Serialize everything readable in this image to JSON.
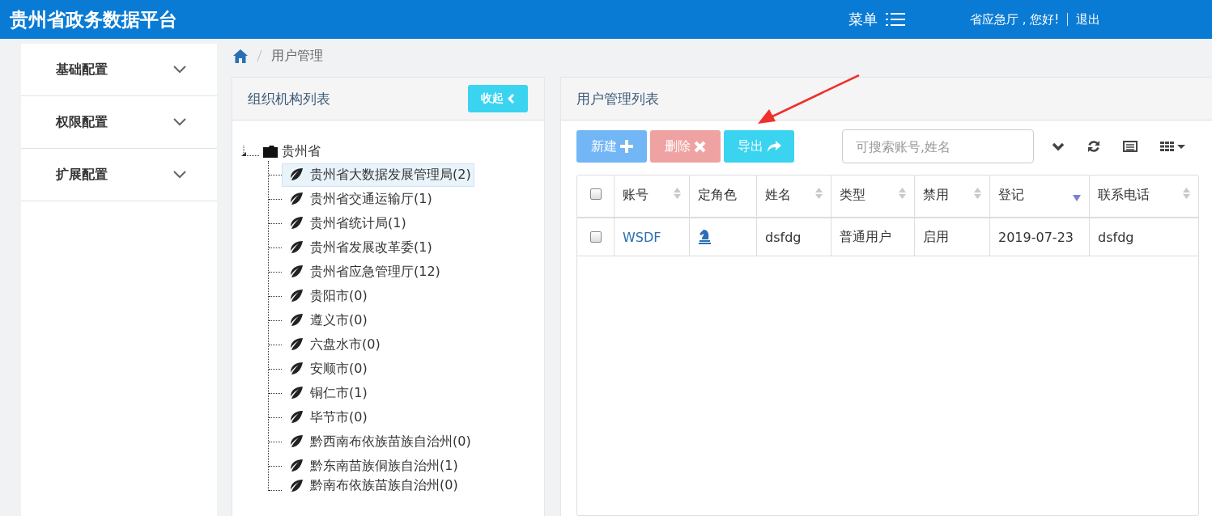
{
  "header": {
    "title": "贵州省政务数据平台",
    "menu_label": "菜单",
    "greeting": "省应急厅 , 您好!",
    "logout": "退出"
  },
  "sidebar": {
    "items": [
      {
        "label": "基础配置",
        "expanded": false
      },
      {
        "label": "权限配置",
        "expanded": false
      },
      {
        "label": "扩展配置",
        "expanded": false
      }
    ]
  },
  "breadcrumb": [
    "用户管理"
  ],
  "org_panel": {
    "title": "组织机构列表",
    "collapse_button": "收起",
    "tree": {
      "label": "贵州省",
      "expanded": true,
      "children": [
        {
          "label": "贵州省大数据发展管理局(2)",
          "selected": true
        },
        {
          "label": "贵州省交通运输厅(1)",
          "selected": false
        },
        {
          "label": "贵州省统计局(1)",
          "selected": false
        },
        {
          "label": "贵州省发展改革委(1)",
          "selected": false
        },
        {
          "label": "贵州省应急管理厅(12)",
          "selected": false
        },
        {
          "label": "贵阳市(0)",
          "selected": false
        },
        {
          "label": "遵义市(0)",
          "selected": false
        },
        {
          "label": "六盘水市(0)",
          "selected": false
        },
        {
          "label": "安顺市(0)",
          "selected": false
        },
        {
          "label": "铜仁市(1)",
          "selected": false
        },
        {
          "label": "毕节市(0)",
          "selected": false
        },
        {
          "label": "黔西南布依族苗族自治州(0)",
          "selected": false
        },
        {
          "label": "黔东南苗族侗族自治州(1)",
          "selected": false
        },
        {
          "label": "黔南布依族苗族自治州(0)",
          "selected": false
        }
      ]
    }
  },
  "user_panel": {
    "title": "用户管理列表",
    "buttons": [
      {
        "label": "新建",
        "kind": "new",
        "disabled": false
      },
      {
        "label": "删除",
        "kind": "delete",
        "disabled": true
      },
      {
        "label": "导出",
        "kind": "export",
        "disabled": false
      }
    ],
    "search": {
      "placeholder": "可搜索账号,姓名"
    },
    "table": {
      "select_all": {
        "checked": false
      },
      "columns": [
        {
          "label": "账号",
          "sortable": true,
          "sorted_desc": false
        },
        {
          "label": "定角色",
          "sortable": false,
          "sorted_desc": false
        },
        {
          "label": "姓名",
          "sortable": true,
          "sorted_desc": false
        },
        {
          "label": "类型",
          "sortable": true,
          "sorted_desc": false
        },
        {
          "label": "禁用",
          "sortable": true,
          "sorted_desc": false
        },
        {
          "label": "登记",
          "sortable": true,
          "sorted_desc": true
        },
        {
          "label": "联系电话",
          "sortable": true,
          "sorted_desc": false
        }
      ],
      "rows": [
        {
          "checked": false,
          "account": "WSDF",
          "name": "dsfdg",
          "type": "普通用户",
          "disabled_state": "启用",
          "registered": "2019-07-23",
          "phone": "dsfdg"
        }
      ]
    }
  }
}
